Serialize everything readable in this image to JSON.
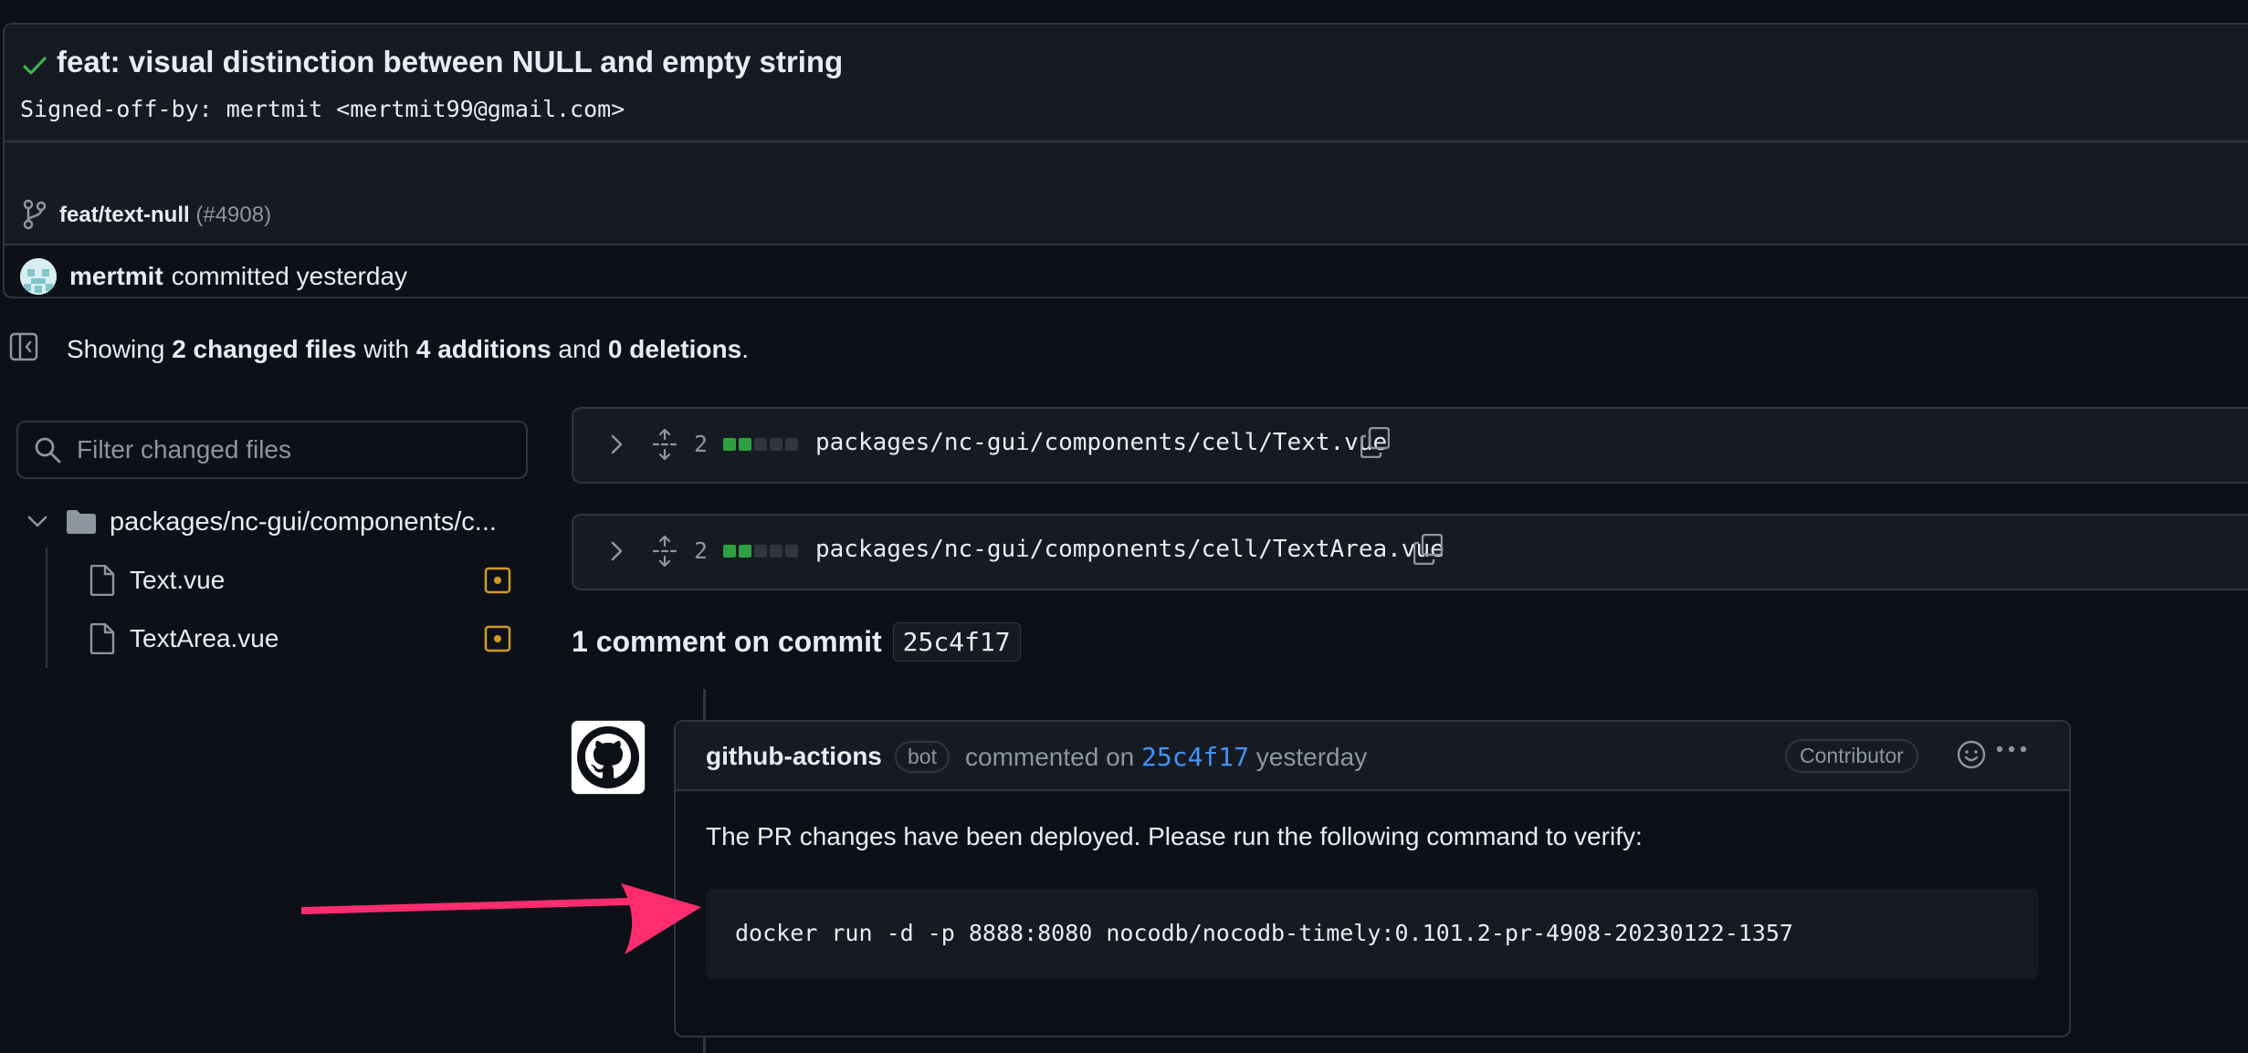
{
  "commit": {
    "title": "feat: visual distinction between NULL and empty string",
    "message": "Signed-off-by: mertmit <mertmit99@gmail.com>",
    "branch": "feat/text-null",
    "pr_number": "(#4908)",
    "author": "mertmit",
    "author_text": "committed yesterday"
  },
  "summary": {
    "prefix": "Showing",
    "files": "2 changed files",
    "mid1": "with",
    "additions": "4 additions",
    "mid2": "and",
    "deletions": "0 deletions",
    "suffix": "."
  },
  "sidebar": {
    "filter_placeholder": "Filter changed files",
    "folder": "packages/nc-gui/components/c...",
    "files": [
      {
        "name": "Text.vue"
      },
      {
        "name": "TextArea.vue"
      }
    ]
  },
  "files": [
    {
      "count": "2",
      "path": "packages/nc-gui/components/cell/Text.vue",
      "added_boxes": 2
    },
    {
      "count": "2",
      "path": "packages/nc-gui/components/cell/TextArea.vue",
      "added_boxes": 2
    }
  ],
  "comments": {
    "heading": "1 comment on commit",
    "sha": "25c4f17"
  },
  "comment": {
    "author": "github-actions",
    "bot_label": "bot",
    "commented_on": "commented on",
    "sha": "25c4f17",
    "when": "yesterday",
    "role": "Contributor",
    "body": "The PR changes have been deployed. Please run the following command to verify:",
    "code": "docker run -d -p 8888:8080 nocodb/nocodb-timely:0.101.2-pr-4908-20230122-1357"
  },
  "colors": {
    "background": "#0d1117",
    "panel": "#161b22",
    "border": "#30363d",
    "success": "#3fb950",
    "warning": "#d29922",
    "link": "#4493f8",
    "arrow": "#ff2d6f"
  }
}
